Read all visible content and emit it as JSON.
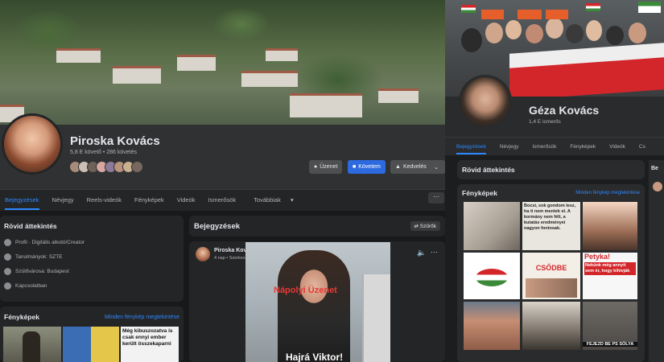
{
  "left_profile": {
    "name": "Piroska Kovács",
    "meta": "5,8 E követő • 286 követés",
    "buttons": {
      "message": "Üzenet",
      "follow": "Követem",
      "likes": "Kedvelés"
    },
    "tabs": [
      "Bejegyzések",
      "Névjegy",
      "Reels-videók",
      "Fényképek",
      "Videók",
      "Ismerősök",
      "Továbbiak"
    ],
    "intro": {
      "title": "Rövid áttekintés",
      "rows": [
        "Profil · Digitális alkotó/Creator",
        "Tanulmányok: SZTE",
        "Szülővárosa: Budapest",
        "Kapcsolatban"
      ]
    },
    "photos": {
      "title": "Fényképek",
      "link": "Minden fénykép megtekintése",
      "tile_text": "Még kibuszozatva is csak ennyi ember került összekaparni"
    },
    "posts": {
      "title": "Bejegyzések",
      "filters": "Szűrők",
      "post_author": "Piroska Kovács · Követem",
      "post_time": "4 nap • Szerkesztve",
      "video_text_top": "Nápolyi Üzenet",
      "video_text_bottom": "Hajrá Viktor!"
    },
    "colors": {
      "accent": "#2d88ff",
      "follow_button": "#2d6adf",
      "video_red": "#e53935"
    }
  },
  "right_profile": {
    "name": "Géza Kovács",
    "meta": "1,4 E ismerős",
    "tabs": [
      "Bejegyzések",
      "Névjegy",
      "Ismerősök",
      "Fényképek",
      "Videók",
      "Cs"
    ],
    "intro": {
      "title": "Rövid áttekintés"
    },
    "photos": {
      "title": "Fényképek",
      "link": "Minden fénykép megtekintése",
      "tile_texts": [
        "Bocsi, sok gondom lesz, ha ti nem mentek el. A kormány nem félt, a kutatás eredményei nagyon fontosak.",
        "CSŐDBE",
        "Petyka!",
        "Nekünk még annyit sem ér, hogy kihívják",
        "FEJEZD BE PS SÓLYA"
      ]
    },
    "side_label": "Be",
    "colors": {
      "accent": "#2d88ff",
      "banner_red": "#d3262a"
    }
  }
}
